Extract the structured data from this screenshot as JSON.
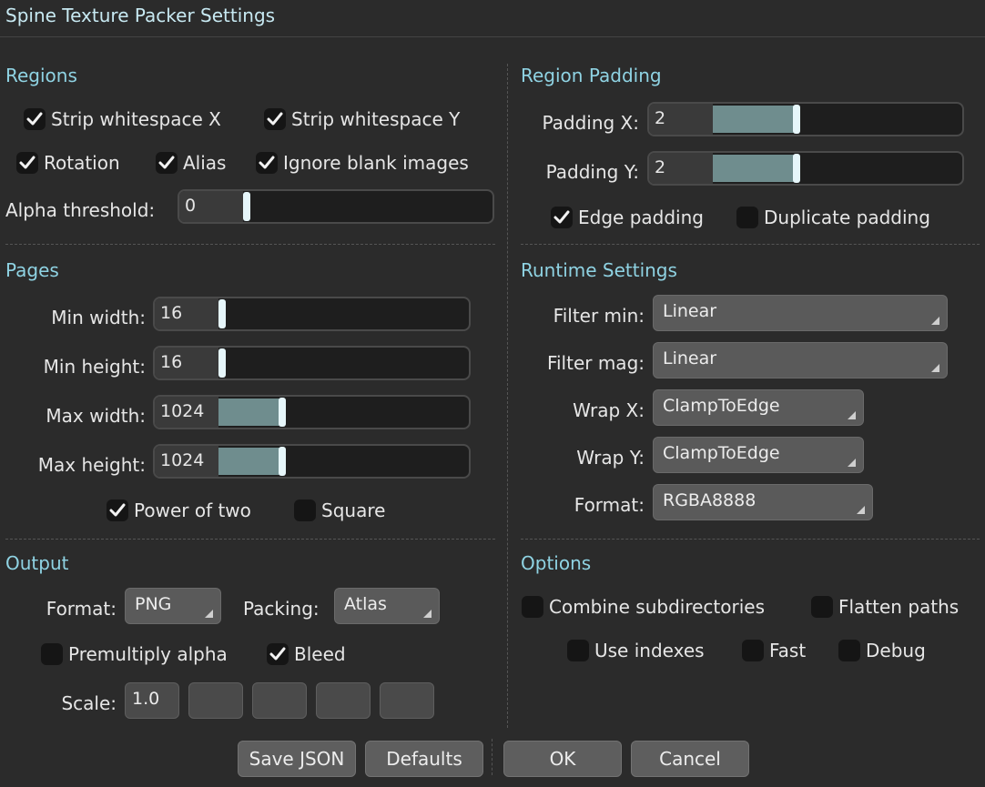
{
  "window": {
    "title": "Spine Texture Packer Settings"
  },
  "regions": {
    "heading": "Regions",
    "strip_x": {
      "label": "Strip whitespace X",
      "checked": true
    },
    "strip_y": {
      "label": "Strip whitespace Y",
      "checked": true
    },
    "rotation": {
      "label": "Rotation",
      "checked": true
    },
    "alias": {
      "label": "Alias",
      "checked": true
    },
    "ignore_blank": {
      "label": "Ignore blank images",
      "checked": true
    },
    "alpha_threshold": {
      "label": "Alpha threshold:",
      "value": "0"
    }
  },
  "region_padding": {
    "heading": "Region Padding",
    "padding_x": {
      "label": "Padding X:",
      "value": "2"
    },
    "padding_y": {
      "label": "Padding Y:",
      "value": "2"
    },
    "edge_padding": {
      "label": "Edge padding",
      "checked": true
    },
    "duplicate_padding": {
      "label": "Duplicate padding",
      "checked": false
    }
  },
  "pages": {
    "heading": "Pages",
    "min_width": {
      "label": "Min width:",
      "value": "16"
    },
    "min_height": {
      "label": "Min height:",
      "value": "16"
    },
    "max_width": {
      "label": "Max width:",
      "value": "1024"
    },
    "max_height": {
      "label": "Max height:",
      "value": "1024"
    },
    "power_of_two": {
      "label": "Power of two",
      "checked": true
    },
    "square": {
      "label": "Square",
      "checked": false
    }
  },
  "runtime": {
    "heading": "Runtime Settings",
    "filter_min": {
      "label": "Filter min:",
      "value": "Linear"
    },
    "filter_mag": {
      "label": "Filter mag:",
      "value": "Linear"
    },
    "wrap_x": {
      "label": "Wrap X:",
      "value": "ClampToEdge"
    },
    "wrap_y": {
      "label": "Wrap Y:",
      "value": "ClampToEdge"
    },
    "format": {
      "label": "Format:",
      "value": "RGBA8888"
    }
  },
  "output": {
    "heading": "Output",
    "format": {
      "label": "Format:",
      "value": "PNG"
    },
    "packing": {
      "label": "Packing:",
      "value": "Atlas"
    },
    "premultiply": {
      "label": "Premultiply alpha",
      "checked": false
    },
    "bleed": {
      "label": "Bleed",
      "checked": true
    },
    "scale": {
      "label": "Scale:",
      "values": [
        "1.0",
        "",
        "",
        "",
        ""
      ]
    }
  },
  "options": {
    "heading": "Options",
    "combine_subdirs": {
      "label": "Combine subdirectories",
      "checked": false
    },
    "flatten_paths": {
      "label": "Flatten paths",
      "checked": false
    },
    "use_indexes": {
      "label": "Use indexes",
      "checked": false
    },
    "fast": {
      "label": "Fast",
      "checked": false
    },
    "debug": {
      "label": "Debug",
      "checked": false
    }
  },
  "buttons": {
    "save_json": "Save JSON",
    "defaults": "Defaults",
    "ok": "OK",
    "cancel": "Cancel"
  },
  "colors": {
    "accent": "#8fd3e3",
    "slider_fill": "#6f8d8e",
    "background": "#2b2b2b"
  }
}
